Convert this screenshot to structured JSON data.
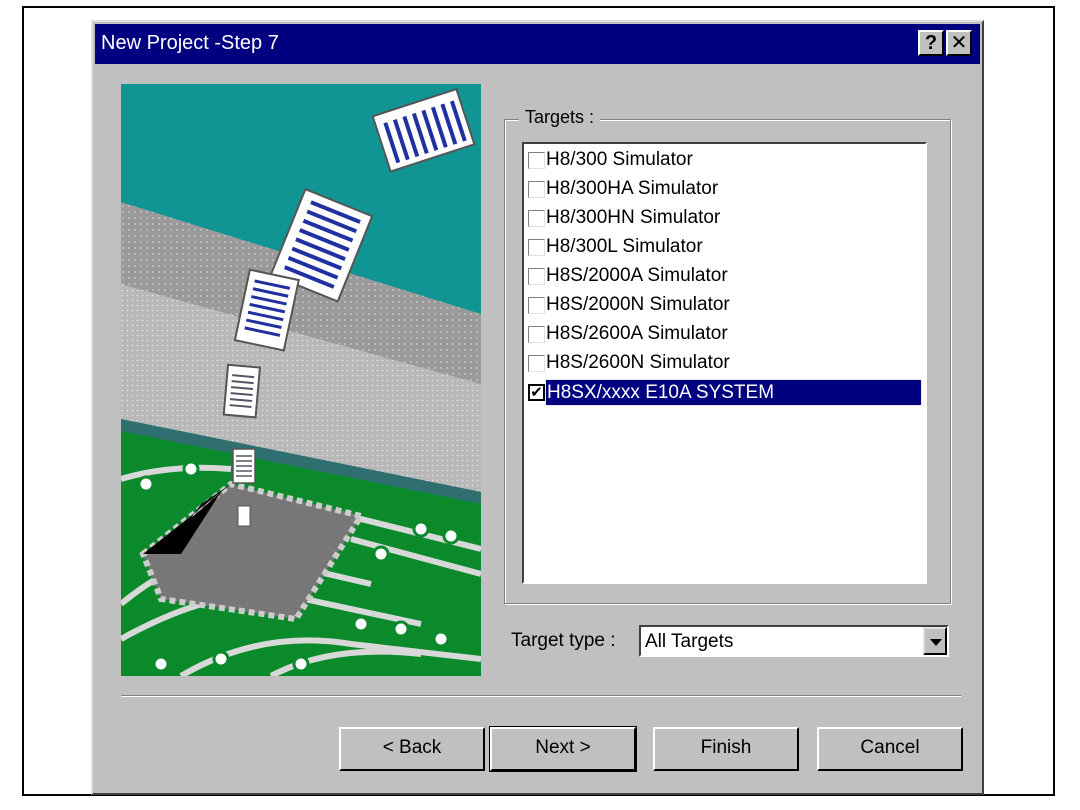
{
  "window": {
    "title": "New Project -Step 7",
    "help_glyph": "?",
    "close_glyph": "✕"
  },
  "targets": {
    "group_label": "Targets :",
    "items": [
      {
        "label": "H8/300 Simulator",
        "checked": false,
        "mark": ""
      },
      {
        "label": "H8/300HA Simulator",
        "checked": false,
        "mark": ""
      },
      {
        "label": "H8/300HN Simulator",
        "checked": false,
        "mark": ""
      },
      {
        "label": "H8/300L Simulator",
        "checked": false,
        "mark": ""
      },
      {
        "label": "H8S/2000A Simulator",
        "checked": false,
        "mark": ""
      },
      {
        "label": "H8S/2000N Simulator",
        "checked": false,
        "mark": ""
      },
      {
        "label": "H8S/2600A Simulator",
        "checked": false,
        "mark": ""
      },
      {
        "label": "H8S/2600N Simulator",
        "checked": false,
        "mark": ""
      },
      {
        "label": "H8SX/xxxx E10A SYSTEM",
        "checked": true,
        "mark": "✔",
        "selected": true
      }
    ]
  },
  "target_type": {
    "label": "Target type :",
    "value": "All Targets"
  },
  "buttons": {
    "back": "< Back",
    "next": "Next >",
    "finish": "Finish",
    "cancel": "Cancel"
  },
  "colors": {
    "titlebar": "#000080",
    "face": "#c0c0c0",
    "teal": "#119494",
    "pcb": "#0a8a2a"
  }
}
